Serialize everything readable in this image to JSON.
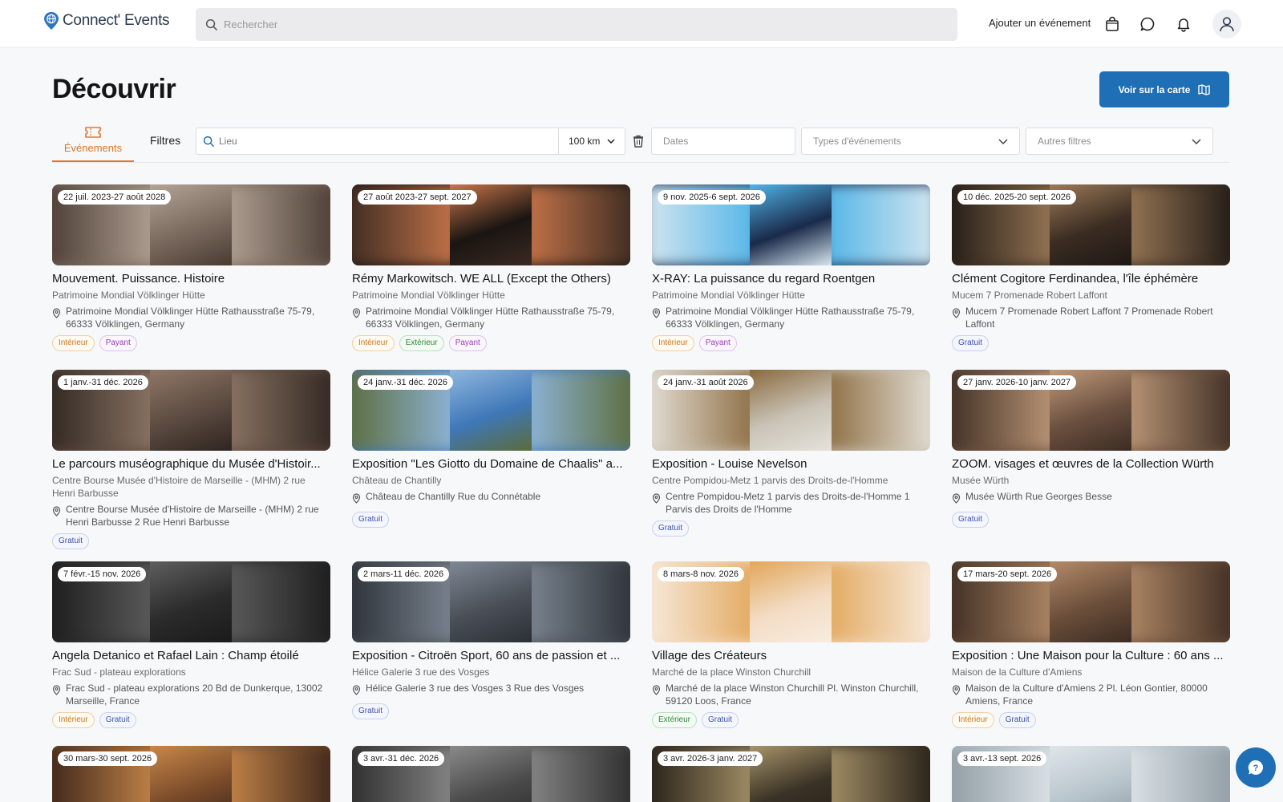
{
  "header": {
    "logo_text": "Connect' Events",
    "search_placeholder": "Rechercher",
    "add_event_label": "Ajouter un événement"
  },
  "page": {
    "title": "Découvrir",
    "map_button_label": "Voir sur la carte"
  },
  "filters": {
    "tab_events_label": "Événements",
    "filters_label": "Filtres",
    "lieu_placeholder": "Lieu",
    "radius_value": "100 km",
    "dates_placeholder": "Dates",
    "types_placeholder": "Types d'événements",
    "autres_placeholder": "Autres filtres"
  },
  "colors": {
    "accent_orange": "#e07a2e",
    "primary_blue": "#1f6fb6"
  },
  "events": [
    {
      "date": "22 juil. 2023-27 août 2028",
      "title": "Mouvement. Puissance. Histoire",
      "venue": "Patrimoine Mondial Völklinger Hütte",
      "address": "Patrimoine Mondial Völklinger Hütte Rathausstraße 75-79, 66333 Völklingen, Germany",
      "tags": [
        {
          "label": "Intérieur",
          "kind": "interieur"
        },
        {
          "label": "Payant",
          "kind": "payant"
        }
      ],
      "palette": [
        "#7a6a5e",
        "#b4a497",
        "#4a3b33"
      ]
    },
    {
      "date": "27 août 2023-27 sept. 2027",
      "title": "Rémy Markowitsch. WE ALL (Except the Others)",
      "venue": "Patrimoine Mondial Völklinger Hütte",
      "address": "Patrimoine Mondial Völklinger Hütte Rathausstraße 75-79, 66333 Völklingen, Germany",
      "tags": [
        {
          "label": "Intérieur",
          "kind": "interieur"
        },
        {
          "label": "Extérieur",
          "kind": "exterieur"
        },
        {
          "label": "Payant",
          "kind": "payant"
        }
      ],
      "palette": [
        "#1a1512",
        "#c9764a",
        "#3a2a22"
      ]
    },
    {
      "date": "9 nov. 2025-6 sept. 2026",
      "title": "X-RAY: La puissance du regard Roentgen",
      "venue": "Patrimoine Mondial Völklinger Hütte",
      "address": "Patrimoine Mondial Völklinger Hütte Rathausstraße 75-79, 66333 Völklingen, Germany",
      "tags": [
        {
          "label": "Intérieur",
          "kind": "interieur"
        },
        {
          "label": "Payant",
          "kind": "payant"
        }
      ],
      "palette": [
        "#1a2a4a",
        "#4fb4e8",
        "#d6e6ef"
      ]
    },
    {
      "date": "10 déc. 2025-20 sept. 2026",
      "title": "Clément Cogitore Ferdinandea, l'île éphémère",
      "venue": "Mucem 7 Promenade Robert Laffont",
      "address": "Mucem 7 Promenade Robert Laffont 7 Promenade Robert Laffont",
      "tags": [
        {
          "label": "Gratuit",
          "kind": "gratuit"
        }
      ],
      "palette": [
        "#3a2c22",
        "#9c7a58",
        "#1e1814"
      ]
    },
    {
      "date": "1 janv.-31 déc. 2026",
      "title": "Le parcours muséographique du Musée d'Histoir...",
      "venue": "Centre Bourse Musée d'Histoire de Marseille - (MHM) 2 rue Henri Barbusse",
      "address": "Centre Bourse Musée d'Histoire de Marseille - (MHM) 2 rue Henri Barbusse 2 Rue Henri Barbusse",
      "tags": [
        {
          "label": "Gratuit",
          "kind": "gratuit"
        }
      ],
      "palette": [
        "#5b4a40",
        "#8f7766",
        "#2e2520"
      ]
    },
    {
      "date": "24 janv.-31 déc. 2026",
      "title": "Exposition \"Les Giotto du Domaine de Chaalis\" a...",
      "venue": "Château de Chantilly",
      "address": "Château de Chantilly Rue du Connétable",
      "tags": [
        {
          "label": "Gratuit",
          "kind": "gratuit"
        }
      ],
      "palette": [
        "#3f78b8",
        "#8fb7de",
        "#5b6b3a"
      ]
    },
    {
      "date": "24 janv.-31 août 2026",
      "title": "Exposition - Louise Nevelson",
      "venue": "Centre Pompidou-Metz 1 parvis des Droits-de-l'Homme",
      "address": "Centre Pompidou-Metz 1 parvis des Droits-de-l'Homme 1 Parvis des Droits de l'Homme",
      "tags": [
        {
          "label": "Gratuit",
          "kind": "gratuit"
        }
      ],
      "palette": [
        "#c9c3b7",
        "#8a6a3e",
        "#e6e2da"
      ]
    },
    {
      "date": "27 janv. 2026-10 janv. 2027",
      "title": "ZOOM. visages et œuvres de la Collection Würth",
      "venue": "Musée Würth",
      "address": "Musée Würth Rue Georges Besse",
      "tags": [
        {
          "label": "Gratuit",
          "kind": "gratuit"
        }
      ],
      "palette": [
        "#6b5040",
        "#c09a7a",
        "#3b2c22"
      ]
    },
    {
      "date": "7 févr.-15 nov. 2026",
      "title": "Angela Detanico et Rafael Lain : Champ étoilé",
      "venue": "Frac Sud - plateau explorations",
      "address": "Frac Sud - plateau explorations 20 Bd de Dunkerque, 13002 Marseille, France",
      "tags": [
        {
          "label": "Intérieur",
          "kind": "interieur"
        },
        {
          "label": "Gratuit",
          "kind": "gratuit"
        }
      ],
      "palette": [
        "#2b2b2b",
        "#5e5e5e",
        "#1a1a1a"
      ]
    },
    {
      "date": "2 mars-11 déc. 2026",
      "title": "Exposition - Citroën Sport, 60 ans de passion et ...",
      "venue": "Hélice Galerie 3 rue des Vosges",
      "address": "Hélice Galerie 3 rue des Vosges 3 Rue des Vosges",
      "tags": [
        {
          "label": "Gratuit",
          "kind": "gratuit"
        }
      ],
      "palette": [
        "#4a4f57",
        "#7e8894",
        "#2b2f35"
      ]
    },
    {
      "date": "8 mars-8 nov. 2026",
      "title": "Village des Créateurs",
      "venue": "Marché de la place Winston Churchill",
      "address": "Marché de la place Winston Churchill Pl. Winston Churchill, 59120 Loos, France",
      "tags": [
        {
          "label": "Extérieur",
          "kind": "exterieur"
        },
        {
          "label": "Gratuit",
          "kind": "gratuit"
        }
      ],
      "palette": [
        "#f3dcc4",
        "#e2a65a",
        "#f8ece0"
      ]
    },
    {
      "date": "17 mars-20 sept. 2026",
      "title": "Exposition : Une Maison pour la Culture : 60 ans ...",
      "venue": "Maison de la Culture d'Amiens",
      "address": "Maison de la Culture d'Amiens 2 Pl. Léon Gontier, 80000 Amiens, France",
      "tags": [
        {
          "label": "Intérieur",
          "kind": "interieur"
        },
        {
          "label": "Gratuit",
          "kind": "gratuit"
        }
      ],
      "palette": [
        "#6a4e3a",
        "#b38a68",
        "#3c2c22"
      ]
    },
    {
      "date": "30 mars-30 sept. 2026",
      "title": "",
      "venue": "",
      "address": "",
      "tags": [],
      "palette": [
        "#7a4b2a",
        "#c8874a",
        "#3a241a"
      ]
    },
    {
      "date": "3 avr.-31 déc. 2026",
      "title": "",
      "venue": "",
      "address": "",
      "tags": [],
      "palette": [
        "#4a4a4a",
        "#8a8a8a",
        "#2a2a2a"
      ]
    },
    {
      "date": "3 avr. 2026-3 janv. 2027",
      "title": "",
      "venue": "",
      "address": "",
      "tags": [],
      "palette": [
        "#3a3226",
        "#a8946a",
        "#241e16"
      ]
    },
    {
      "date": "3 avr.-13 sept. 2026",
      "title": "",
      "venue": "",
      "address": "",
      "tags": [],
      "palette": [
        "#b8c4cc",
        "#dfe6ea",
        "#8e9aa2"
      ]
    }
  ]
}
